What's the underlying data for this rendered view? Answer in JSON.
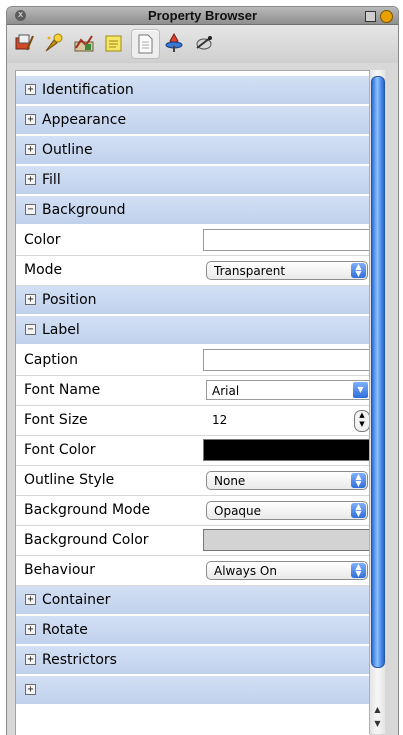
{
  "window": {
    "title": "Property Browser",
    "close_glyph": "x",
    "toolbar_icons": [
      "wizard-icon",
      "sparkle-brush-icon",
      "graph-icon",
      "notes-icon",
      "document-icon",
      "sprite-icon",
      "script-icon"
    ],
    "active_tool_index": 4
  },
  "sections": {
    "identification": "Identification",
    "appearance": "Appearance",
    "outline": "Outline",
    "fill": "Fill",
    "background": "Background",
    "position": "Position",
    "label": "Label",
    "container": "Container",
    "rotate": "Rotate",
    "restrictors": "Restrictors"
  },
  "expander_glyphs": {
    "collapsed": "+",
    "expanded": "−"
  },
  "background": {
    "color_label": "Color",
    "color_value": "",
    "mode_label": "Mode",
    "mode_value": "Transparent"
  },
  "label": {
    "caption_label": "Caption",
    "caption_value": "",
    "font_name_label": "Font Name",
    "font_name_value": "Arial",
    "font_size_label": "Font Size",
    "font_size_value": "12",
    "font_color_label": "Font Color",
    "font_color_value": "#000000",
    "outline_style_label": "Outline Style",
    "outline_style_value": "None",
    "background_mode_label": "Background Mode",
    "background_mode_value": "Opaque",
    "background_color_label": "Background Color",
    "background_color_value": "#d3d3d3",
    "behaviour_label": "Behaviour",
    "behaviour_value": "Always On"
  },
  "colors": {
    "section_header": "#c9d8f0",
    "scroll_thumb": "#4a86e8"
  }
}
